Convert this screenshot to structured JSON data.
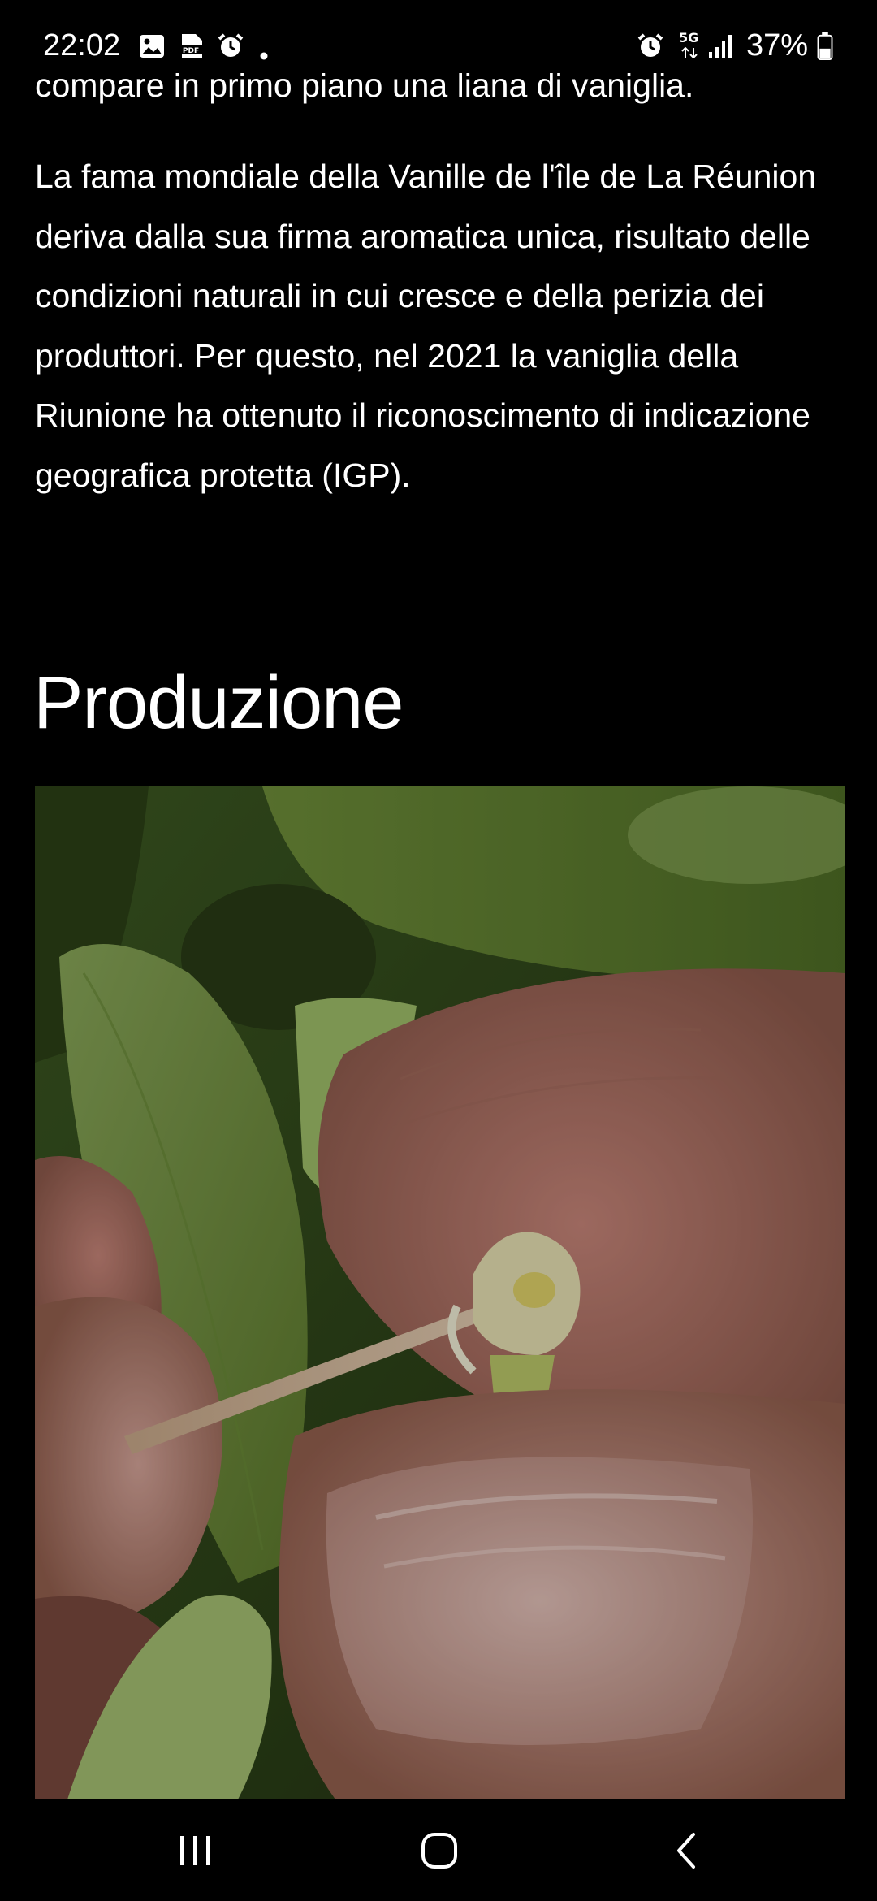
{
  "status_bar": {
    "time": "22:02",
    "battery_percent": "37%",
    "network_label": "5G",
    "icons": [
      "gallery-icon",
      "pdf-icon",
      "alarm-icon",
      "notification-dot-icon",
      "alarm-icon",
      "5g-data-icon",
      "signal-icon",
      "battery-icon"
    ]
  },
  "article": {
    "clipped_line": "compare in primo piano una liana di vaniglia.",
    "paragraph": "La fama mondiale della Vanille de l'île de La Réunion deriva dalla sua firma aromatica unica, risultato delle condizioni naturali in cui cresce e della perizia dei produttori. Per questo, nel 2021 la vaniglia della Riunione ha ottenuto il riconoscimento di indicazione geografica protetta (IGP).",
    "section_title": "Produzione",
    "photo_icon": "vanilla-pollination-photo"
  },
  "nav_bar": {
    "buttons": [
      "recent-apps-icon",
      "home-icon",
      "back-icon"
    ]
  },
  "colors": {
    "background": "#000000",
    "text": "#ffffff"
  }
}
